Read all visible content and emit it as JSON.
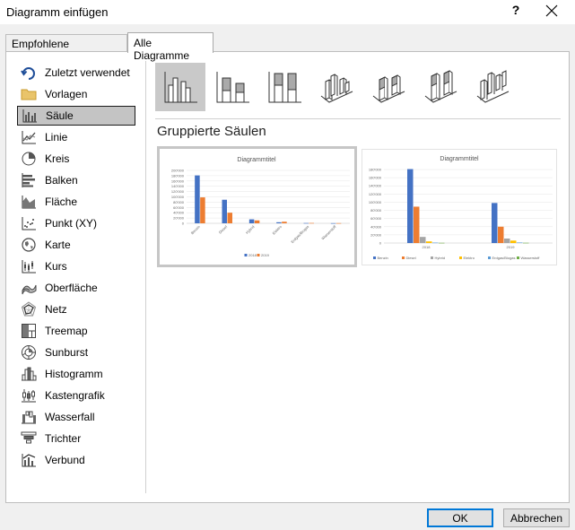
{
  "window": {
    "title": "Diagramm einfügen",
    "help": "?"
  },
  "tabs": [
    {
      "label": "Empfohlene Diagramme",
      "active": false
    },
    {
      "label": "Alle Diagramme",
      "active": true
    }
  ],
  "sidebar": {
    "items": [
      {
        "label": "Zuletzt verwendet",
        "icon": "recent-icon"
      },
      {
        "label": "Vorlagen",
        "icon": "folder-icon"
      },
      {
        "label": "Säule",
        "icon": "column-chart-icon",
        "selected": true
      },
      {
        "label": "Linie",
        "icon": "line-chart-icon"
      },
      {
        "label": "Kreis",
        "icon": "pie-chart-icon"
      },
      {
        "label": "Balken",
        "icon": "bar-chart-icon"
      },
      {
        "label": "Fläche",
        "icon": "area-chart-icon"
      },
      {
        "label": "Punkt (XY)",
        "icon": "scatter-chart-icon"
      },
      {
        "label": "Karte",
        "icon": "map-chart-icon"
      },
      {
        "label": "Kurs",
        "icon": "stock-chart-icon"
      },
      {
        "label": "Oberfläche",
        "icon": "surface-chart-icon"
      },
      {
        "label": "Netz",
        "icon": "radar-chart-icon"
      },
      {
        "label": "Treemap",
        "icon": "treemap-icon"
      },
      {
        "label": "Sunburst",
        "icon": "sunburst-icon"
      },
      {
        "label": "Histogramm",
        "icon": "histogram-icon"
      },
      {
        "label": "Kastengrafik",
        "icon": "box-whisker-icon"
      },
      {
        "label": "Wasserfall",
        "icon": "waterfall-icon"
      },
      {
        "label": "Trichter",
        "icon": "funnel-icon"
      },
      {
        "label": "Verbund",
        "icon": "combo-chart-icon"
      }
    ]
  },
  "subtypes": {
    "selected_index": 0,
    "items": [
      {
        "icon": "clustered-column-icon"
      },
      {
        "icon": "stacked-column-icon"
      },
      {
        "icon": "stacked-100-column-icon"
      },
      {
        "icon": "3d-clustered-column-icon"
      },
      {
        "icon": "3d-stacked-column-icon"
      },
      {
        "icon": "3d-stacked-100-column-icon"
      },
      {
        "icon": "3d-column-icon"
      }
    ]
  },
  "subtype_title": "Gruppierte Säulen",
  "colors": {
    "blue": "#4472c4",
    "orange": "#ed7d31",
    "gray": "#a5a5a5",
    "yellow": "#ffc000",
    "lightblue": "#5b9bd5",
    "green": "#70ad47"
  },
  "previews": [
    {
      "title": "Diagrammtitel",
      "yticks": [
        "0",
        "20'000",
        "40'000",
        "60'000",
        "80'000",
        "100'000",
        "120'000",
        "140'000",
        "160'000",
        "180'000",
        "200'000"
      ],
      "categories": [
        "Benzin",
        "Diesel",
        "Hybrid",
        "Elektro",
        "Erdgas/Biogas",
        "Wasserstoff"
      ],
      "legend": [
        "2018",
        "2019"
      ]
    },
    {
      "title": "Diagrammtitel",
      "yticks": [
        "0",
        "20'000",
        "40'000",
        "60'000",
        "80'000",
        "100'000",
        "120'000",
        "140'000",
        "160'000",
        "180'000"
      ],
      "categories": [
        "2018",
        "2019"
      ],
      "legend": [
        "Benzin",
        "Diesel",
        "Hybrid",
        "Elektro",
        "Erdgas/Biogas",
        "Wasserstoff"
      ]
    }
  ],
  "chart_data": [
    {
      "type": "bar",
      "title": "Diagrammtitel",
      "categories": [
        "Benzin",
        "Diesel",
        "Hybrid",
        "Elektro",
        "Erdgas/Biogas",
        "Wasserstoff"
      ],
      "series": [
        {
          "name": "2018",
          "values": [
            181000,
            89000,
            15000,
            4000,
            1000,
            500
          ]
        },
        {
          "name": "2019",
          "values": [
            98000,
            40000,
            11000,
            6000,
            1200,
            600
          ]
        }
      ],
      "ylim": [
        0,
        200000
      ]
    },
    {
      "type": "bar",
      "title": "Diagrammtitel",
      "categories": [
        "2018",
        "2019"
      ],
      "series": [
        {
          "name": "Benzin",
          "values": [
            181000,
            98000
          ]
        },
        {
          "name": "Diesel",
          "values": [
            89000,
            40000
          ]
        },
        {
          "name": "Hybrid",
          "values": [
            15000,
            11000
          ]
        },
        {
          "name": "Elektro",
          "values": [
            4000,
            6000
          ]
        },
        {
          "name": "Erdgas/Biogas",
          "values": [
            1000,
            1200
          ]
        },
        {
          "name": "Wasserstoff",
          "values": [
            500,
            600
          ]
        }
      ],
      "ylim": [
        0,
        180000
      ]
    }
  ],
  "buttons": {
    "ok": "OK",
    "cancel": "Abbrechen"
  }
}
